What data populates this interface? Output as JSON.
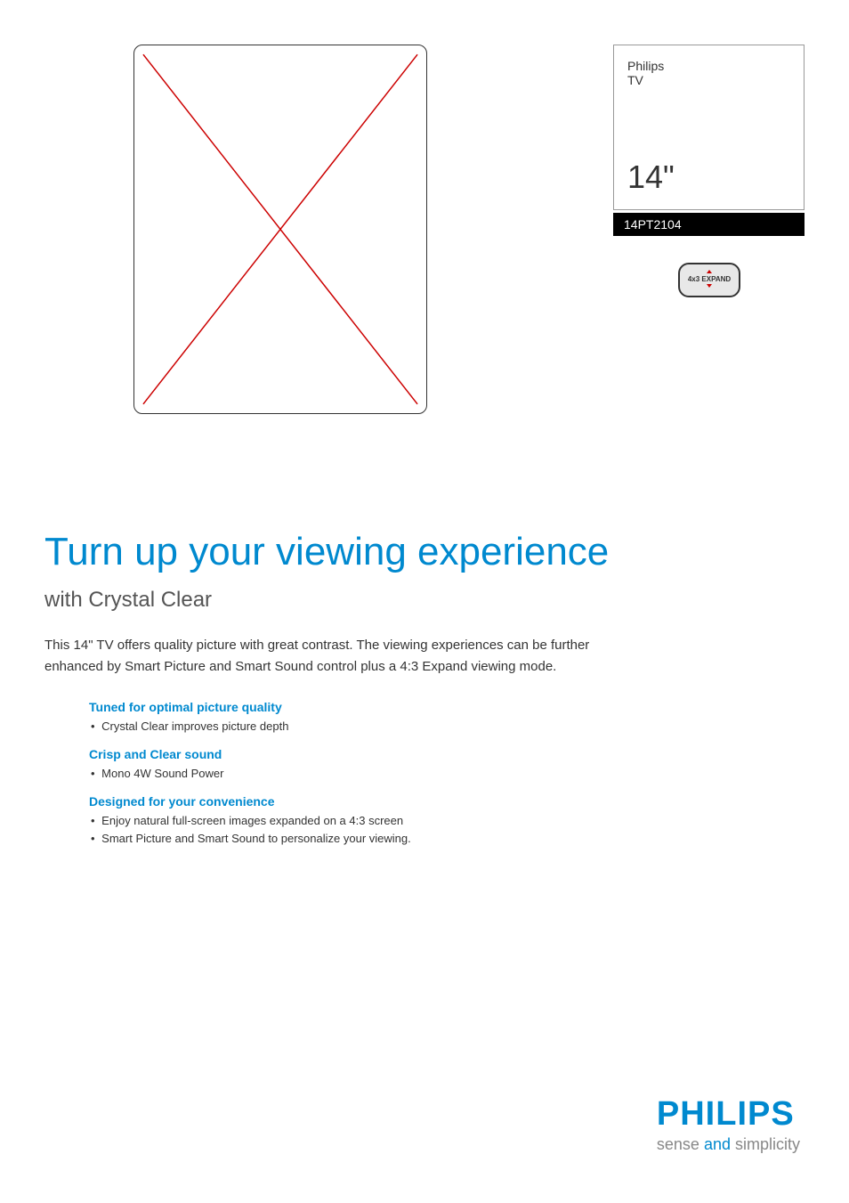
{
  "header": {
    "brand": "Philips",
    "productType": "TV",
    "screenSize": "14\"",
    "modelNumber": "14PT2104",
    "badgeText": "4x3 EXPAND"
  },
  "content": {
    "headline": "Turn up your viewing experience",
    "subheadline": "with Crystal Clear",
    "description": "This 14\" TV offers quality picture with great contrast. The viewing experiences can be further enhanced by Smart Picture and Smart Sound control plus a 4:3 Expand viewing mode."
  },
  "features": {
    "groups": [
      {
        "title": "Tuned for optimal picture quality",
        "items": [
          "Crystal Clear improves picture depth"
        ]
      },
      {
        "title": "Crisp and Clear sound",
        "items": [
          "Mono 4W Sound Power"
        ]
      },
      {
        "title": "Designed for your convenience",
        "items": [
          "Enjoy natural full-screen images expanded on a 4:3 screen",
          "Smart Picture and Smart Sound to personalize your viewing."
        ]
      }
    ]
  },
  "footer": {
    "logo": "PHILIPS",
    "taglinePart1": "sense ",
    "taglineAccent": "and",
    "taglinePart2": " simplicity"
  }
}
